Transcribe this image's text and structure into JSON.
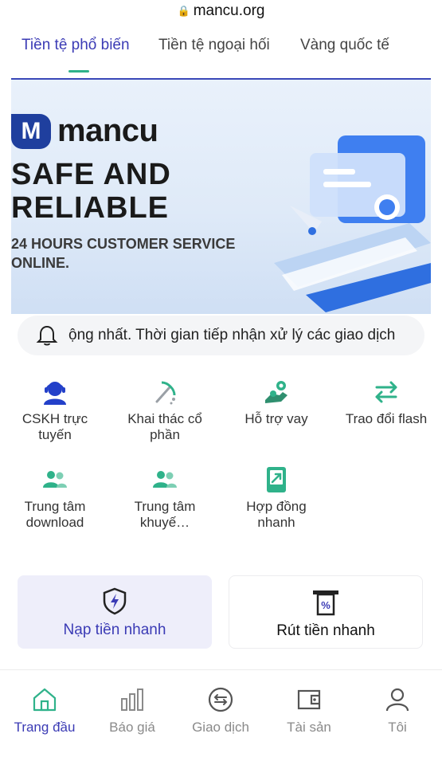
{
  "browser": {
    "url": "mancu.org"
  },
  "tabs": [
    {
      "label": "Tiền tệ phổ biến",
      "active": true
    },
    {
      "label": "Tiền tệ ngoại hối",
      "active": false
    },
    {
      "label": "Vàng quốc tế",
      "active": false
    }
  ],
  "banner": {
    "logo_text": "mancu",
    "headline_line1": "SAFE AND",
    "headline_line2": "RELIABLE",
    "subline": "24 HOURS CUSTOMER SERVICE ONLINE."
  },
  "notice": {
    "text": "ộng nhất. Thời gian tiếp nhận xử lý các giao dịch",
    "icon": "bell-icon"
  },
  "quick_grid": [
    {
      "label": "CSKH trực tuyến",
      "icon": "support-agent-icon"
    },
    {
      "label": "Khai thác cổ phần",
      "icon": "pickaxe-icon"
    },
    {
      "label": "Hỗ trợ vay",
      "icon": "loan-support-icon"
    },
    {
      "label": "Trao đổi flash",
      "icon": "exchange-arrows-icon"
    },
    {
      "label": "Trung tâm download",
      "icon": "users-download-icon"
    },
    {
      "label": "Trung tâm khuyế…",
      "icon": "users-promo-icon"
    },
    {
      "label": "Hợp đồng nhanh",
      "icon": "contract-icon"
    }
  ],
  "actions": {
    "deposit_label": "Nạp tiền nhanh",
    "withdraw_label": "Rút tiền nhanh"
  },
  "bottom_nav": [
    {
      "label": "Trang đầu",
      "icon": "home-icon",
      "active": true
    },
    {
      "label": "Báo giá",
      "icon": "bar-chart-icon",
      "active": false
    },
    {
      "label": "Giao dịch",
      "icon": "swap-circle-icon",
      "active": false
    },
    {
      "label": "Tài sản",
      "icon": "wallet-icon",
      "active": false
    },
    {
      "label": "Tôi",
      "icon": "user-icon",
      "active": false
    }
  ],
  "colors": {
    "accent": "#3b3bb5",
    "green": "#2fb28a",
    "nav_inactive": "#8a8a8a"
  }
}
